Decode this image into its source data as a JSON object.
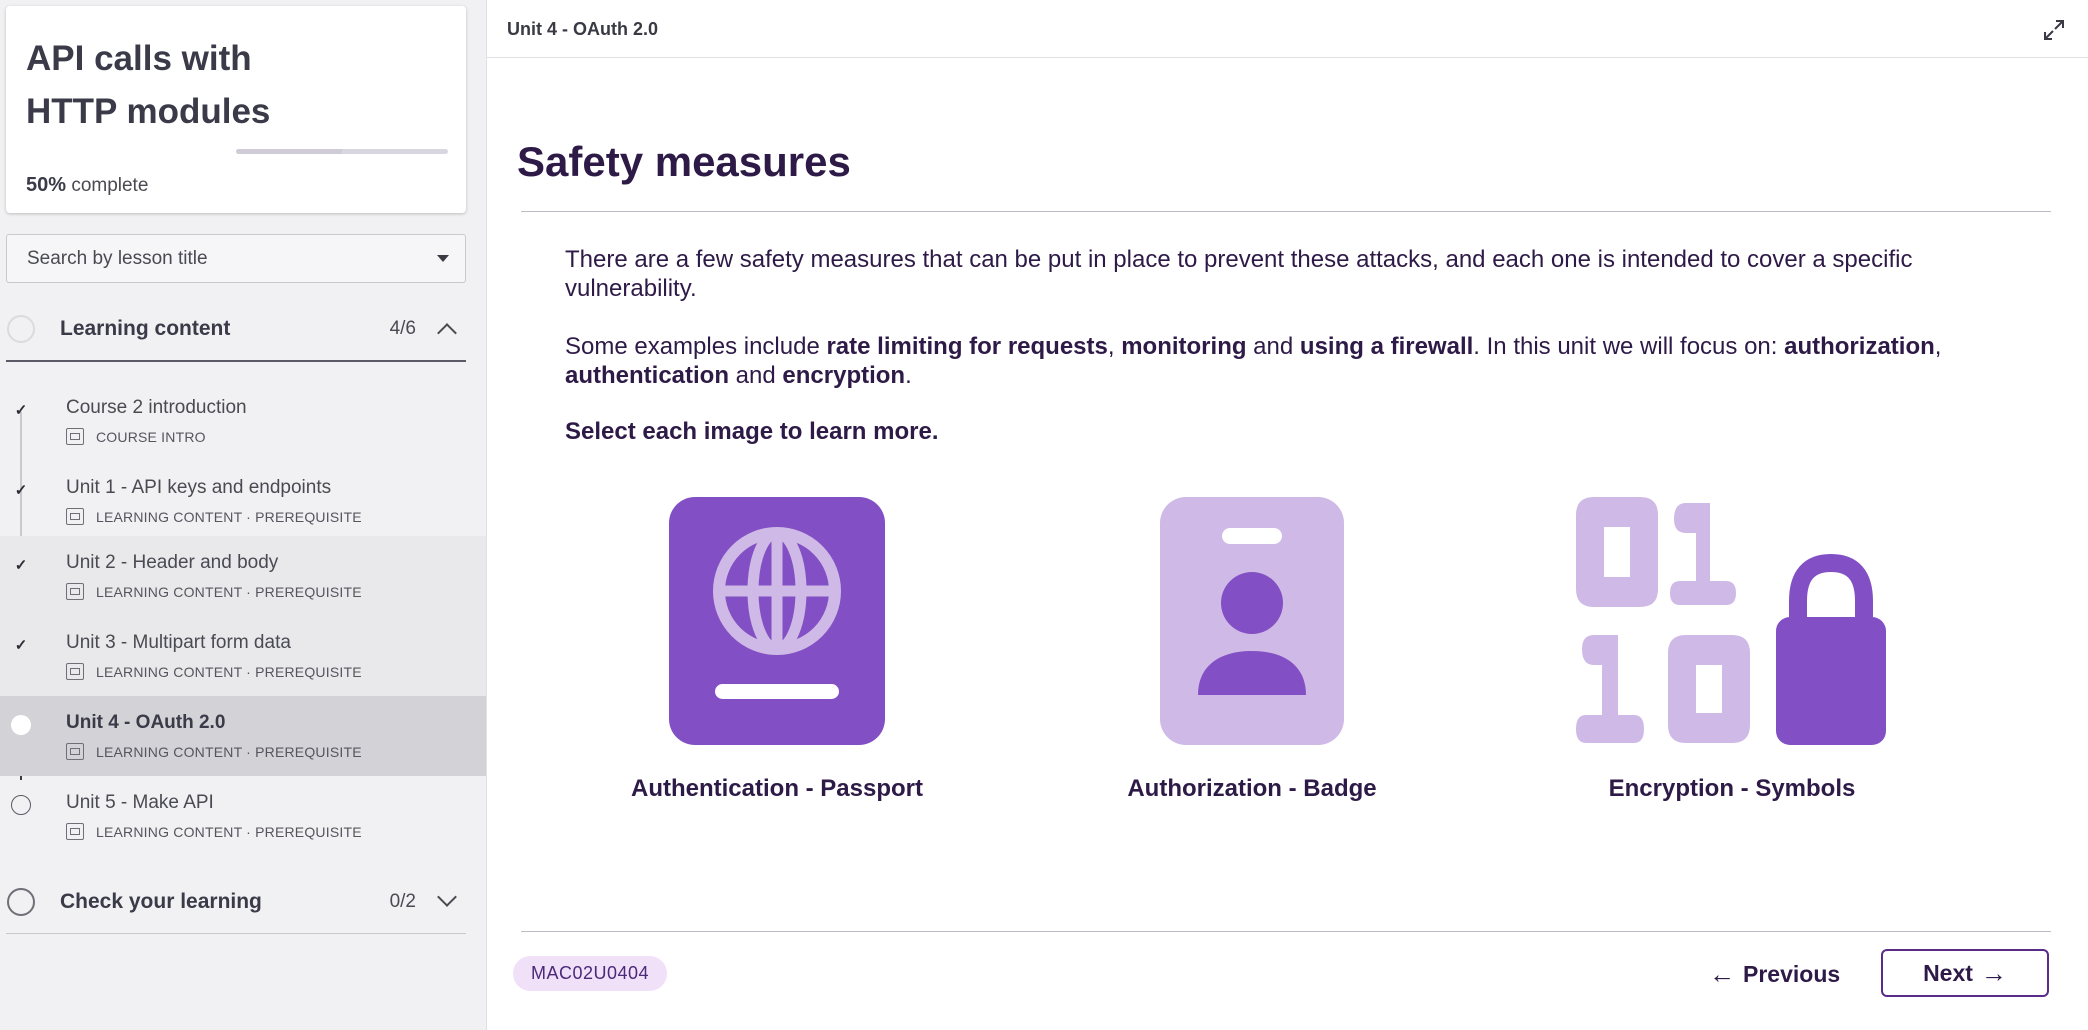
{
  "course": {
    "title": "API calls with HTTP modules",
    "progress_percent": 50,
    "progress_value": "50%",
    "progress_suffix": "complete"
  },
  "search": {
    "placeholder": "Search by lesson title"
  },
  "sections": [
    {
      "title": "Learning content",
      "count": "4/6",
      "expanded": true,
      "lessons": [
        {
          "name": "Course 2 introduction",
          "meta": "COURSE INTRO",
          "status": "done"
        },
        {
          "name": "Unit 1 - API keys and endpoints",
          "meta": "LEARNING CONTENT · PREREQUISITE",
          "status": "done"
        },
        {
          "name": "Unit 2 - Header and body",
          "meta": "LEARNING CONTENT · PREREQUISITE",
          "status": "done"
        },
        {
          "name": "Unit 3 - Multipart form data",
          "meta": "LEARNING CONTENT · PREREQUISITE",
          "status": "done"
        },
        {
          "name": "Unit 4 - OAuth 2.0",
          "meta": "LEARNING CONTENT · PREREQUISITE",
          "status": "current"
        },
        {
          "name": "Unit 5 - Make API",
          "meta": "LEARNING CONTENT · PREREQUISITE",
          "status": "todo"
        }
      ]
    },
    {
      "title": "Check your learning",
      "count": "0/2",
      "expanded": false
    }
  ],
  "main": {
    "breadcrumb": "Unit 4 - OAuth 2.0",
    "heading": "Safety measures",
    "para1": "There are a few safety measures that can be put in place to prevent these attacks, and each one is intended to cover a specific vulnerability.",
    "para2": {
      "t1": "Some examples include ",
      "b1": "rate limiting for requests",
      "t2": ", ",
      "b2": "monitoring",
      "t3": " and ",
      "b3": "using a firewall",
      "t4": ". In this unit we will focus on: ",
      "b4": "authorization",
      "t5": ", ",
      "b5": "authentication",
      "t6": " and ",
      "b6": "encryption",
      "t7": "."
    },
    "instruction": "Select each image to learn more.",
    "tiles": [
      {
        "caption": "Authentication - Passport",
        "icon": "passport-icon"
      },
      {
        "caption": "Authorization - Badge",
        "icon": "badge-icon"
      },
      {
        "caption": "Encryption - Symbols",
        "icon": "binary-lock-icon"
      }
    ],
    "unit_code": "MAC02U0404",
    "prev_label": "Previous",
    "next_label": "Next"
  },
  "colors": {
    "accent_dark": "#2e1a47",
    "purple": "#8250c4",
    "lavender": "#cfb9e6",
    "tag_bg": "#f0e0f8"
  }
}
